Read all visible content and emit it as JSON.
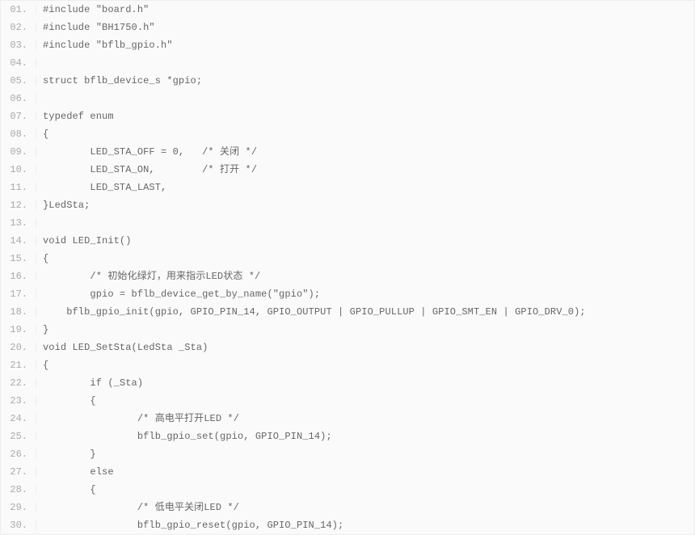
{
  "lines": [
    {
      "num": "01.",
      "code": "#include \"board.h\""
    },
    {
      "num": "02.",
      "code": "#include \"BH1750.h\""
    },
    {
      "num": "03.",
      "code": "#include \"bflb_gpio.h\""
    },
    {
      "num": "04.",
      "code": ""
    },
    {
      "num": "05.",
      "code": "struct bflb_device_s *gpio;"
    },
    {
      "num": "06.",
      "code": ""
    },
    {
      "num": "07.",
      "code": "typedef enum"
    },
    {
      "num": "08.",
      "code": "{"
    },
    {
      "num": "09.",
      "code": "        LED_STA_OFF = 0,   /* 关闭 */"
    },
    {
      "num": "10.",
      "code": "        LED_STA_ON,        /* 打开 */"
    },
    {
      "num": "11.",
      "code": "        LED_STA_LAST,"
    },
    {
      "num": "12.",
      "code": "}LedSta;"
    },
    {
      "num": "13.",
      "code": ""
    },
    {
      "num": "14.",
      "code": "void LED_Init()"
    },
    {
      "num": "15.",
      "code": "{"
    },
    {
      "num": "16.",
      "code": "        /* 初始化绿灯，用来指示LED状态 */"
    },
    {
      "num": "17.",
      "code": "        gpio = bflb_device_get_by_name(\"gpio\");"
    },
    {
      "num": "18.",
      "code": "    bflb_gpio_init(gpio, GPIO_PIN_14, GPIO_OUTPUT | GPIO_PULLUP | GPIO_SMT_EN | GPIO_DRV_0);"
    },
    {
      "num": "19.",
      "code": "}"
    },
    {
      "num": "20.",
      "code": "void LED_SetSta(LedSta _Sta)"
    },
    {
      "num": "21.",
      "code": "{"
    },
    {
      "num": "22.",
      "code": "        if (_Sta)"
    },
    {
      "num": "23.",
      "code": "        {"
    },
    {
      "num": "24.",
      "code": "                /* 高电平打开LED */"
    },
    {
      "num": "25.",
      "code": "                bflb_gpio_set(gpio, GPIO_PIN_14);"
    },
    {
      "num": "26.",
      "code": "        }"
    },
    {
      "num": "27.",
      "code": "        else"
    },
    {
      "num": "28.",
      "code": "        {"
    },
    {
      "num": "29.",
      "code": "                /* 低电平关闭LED */"
    },
    {
      "num": "30.",
      "code": "                bflb_gpio_reset(gpio, GPIO_PIN_14);"
    }
  ]
}
